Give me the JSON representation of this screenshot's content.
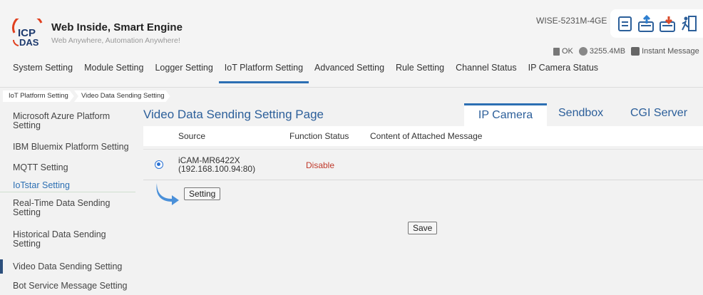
{
  "brand": {
    "title": "Web Inside, Smart Engine",
    "subtitle": "Web Anywhere, Automation Anywhere!",
    "logo_top": "ICP",
    "logo_bottom": "DAS"
  },
  "header": {
    "model": "WISE-5231M-4GE",
    "icons": [
      "document-icon",
      "upload-icon",
      "download-icon",
      "logout-icon"
    ],
    "status": {
      "state": "OK",
      "storage": "3255.4MB",
      "message": "Instant Message"
    }
  },
  "nav": {
    "tabs": [
      {
        "label": "System Setting"
      },
      {
        "label": "Module Setting"
      },
      {
        "label": "Logger Setting"
      },
      {
        "label": "IoT Platform Setting"
      },
      {
        "label": "Advanced Setting"
      },
      {
        "label": "Rule Setting"
      },
      {
        "label": "Channel Status"
      },
      {
        "label": "IP Camera Status"
      }
    ],
    "active": "IoT Platform Setting"
  },
  "breadcrumb": [
    "IoT Platform Setting",
    "Video Data Sending Setting"
  ],
  "sidebar": {
    "items": [
      {
        "label": "Microsoft Azure Platform Setting"
      },
      {
        "label": "IBM Bluemix Platform Setting"
      },
      {
        "label": "MQTT Setting"
      },
      {
        "label": "IoTstar Setting"
      },
      {
        "label": "Real-Time Data Sending Setting"
      },
      {
        "label": "Historical Data Sending Setting"
      },
      {
        "label": "Video Data Sending Setting"
      },
      {
        "label": "Bot Service Message Setting"
      }
    ],
    "active": "Video Data Sending Setting"
  },
  "main": {
    "title": "Video Data Sending Setting Page",
    "tabs": [
      {
        "label": "IP Camera"
      },
      {
        "label": "Sendbox"
      },
      {
        "label": "CGI Server"
      }
    ],
    "active_tab": "IP Camera",
    "columns": [
      "Source",
      "Function Status",
      "Content of Attached Message"
    ],
    "rows": [
      {
        "name": "iCAM-MR6422X",
        "address": "(192.168.100.94:80)",
        "status": "Disable",
        "message": "",
        "selected": true
      }
    ],
    "setting_button": "Setting",
    "save_button": "Save"
  },
  "colors": {
    "accent": "#2c6fb3",
    "title": "#2c5f9a",
    "disable": "#c0392b"
  }
}
